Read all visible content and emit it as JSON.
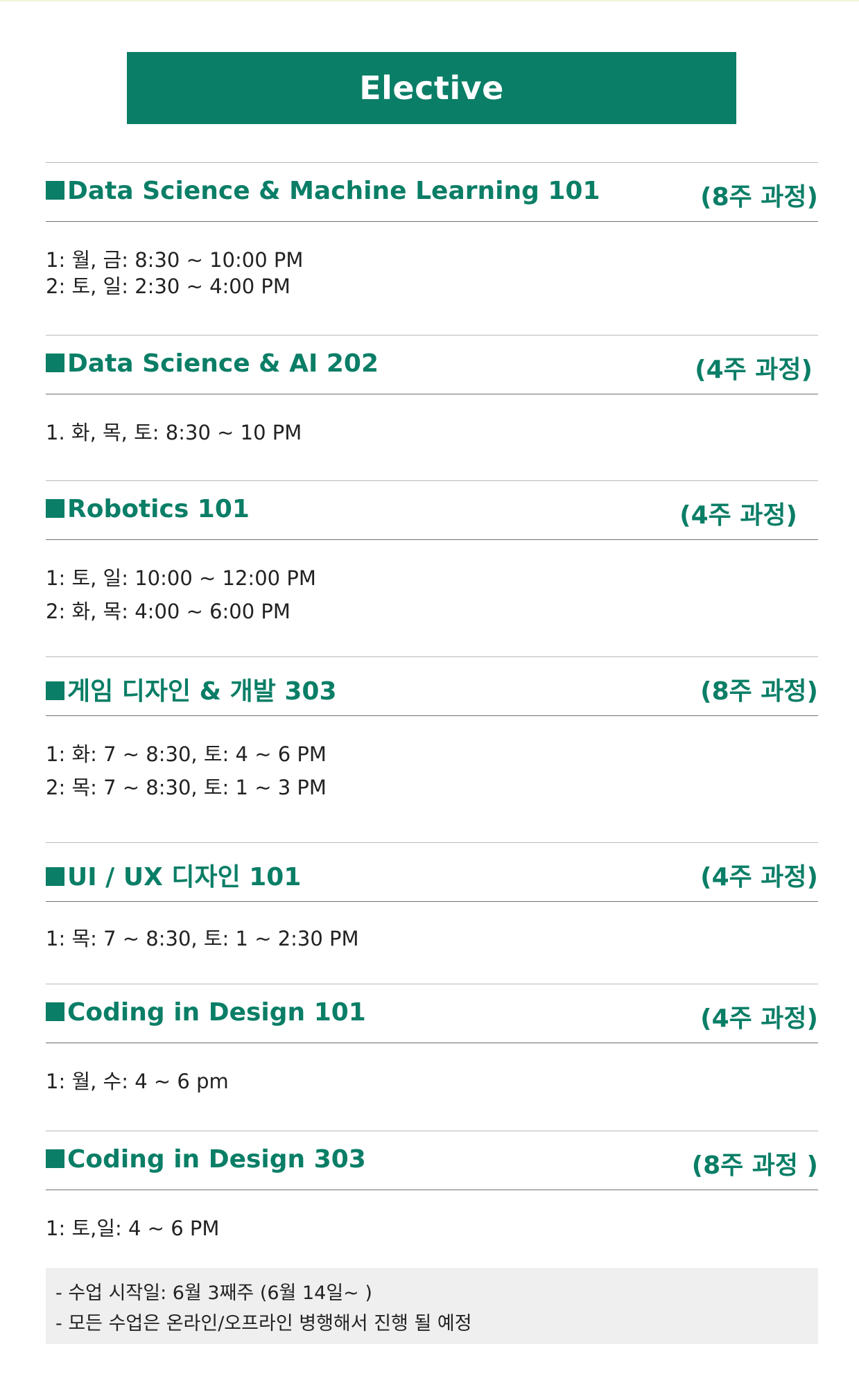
{
  "header": {
    "title": "Elective"
  },
  "courses": [
    {
      "title": "Data Science & Machine Learning 101",
      "duration": "(8주 과정)",
      "schedule": [
        "1: 월, 금: 8:30 ~ 10:00 PM",
        "2: 토, 일: 2:30 ~ 4:00 PM"
      ]
    },
    {
      "title": "Data Science & AI 202",
      "duration": "(4주 과정)",
      "schedule": [
        "1. 화, 목, 토: 8:30 ~ 10 PM"
      ]
    },
    {
      "title": "Robotics 101",
      "duration": "(4주 과정)",
      "schedule": [
        "1: 토, 일: 10:00 ~ 12:00 PM",
        "2: 화, 목: 4:00 ~ 6:00 PM"
      ]
    },
    {
      "title": "게임 디자인 & 개발 303",
      "duration": "(8주 과정)",
      "schedule": [
        "1: 화: 7 ~ 8:30, 토: 4 ~ 6 PM",
        "2: 목: 7 ~ 8:30, 토: 1 ~ 3 PM"
      ]
    },
    {
      "title": "UI / UX 디자인 101",
      "duration": "(4주 과정)",
      "schedule": [
        "1: 목: 7 ~ 8:30, 토: 1 ~ 2:30 PM"
      ]
    },
    {
      "title": "Coding in Design 101",
      "duration": "(4주 과정)",
      "schedule": [
        "1: 월, 수: 4 ~ 6 pm"
      ]
    },
    {
      "title": "Coding in Design 303",
      "duration": "(8주 과정 )",
      "schedule": [
        "1: 토,일: 4 ~ 6 PM"
      ]
    }
  ],
  "notes": [
    "- 수업 시작일: 6월 3째주 (6월 14일~ )",
    "- 모든 수업은 온라인/오프라인 병행해서 진행 될 예정"
  ],
  "colors": {
    "accent": "#0a7e66",
    "note_bg": "#efefef"
  }
}
